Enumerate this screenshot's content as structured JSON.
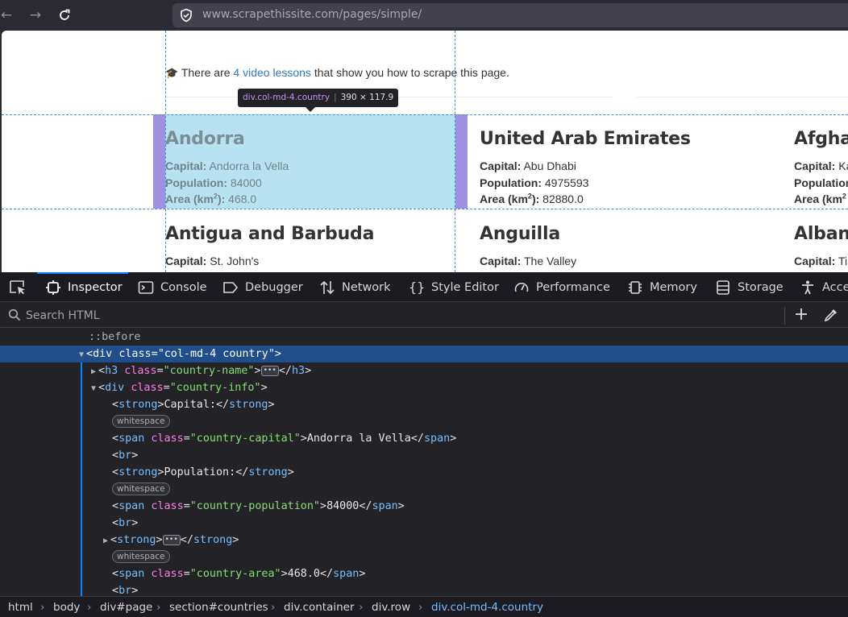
{
  "browser": {
    "url_host": "www.scrapethissite.com",
    "url_path": "/pages/simple/"
  },
  "page": {
    "lessons_pre": "There are ",
    "lessons_link": "4 video lessons",
    "lessons_post": " that show you how to scrape this page.",
    "tooltip_selector": "div.col-md-4.country",
    "tooltip_dims": "390 × 117.9",
    "countries": [
      {
        "name": "Andorra",
        "capital": "Andorra la Vella",
        "population": "84000",
        "area": "468.0"
      },
      {
        "name": "United Arab Emirates",
        "capital": "Abu Dhabi",
        "population": "4975593",
        "area": "82880.0"
      },
      {
        "name": "Afghan",
        "capital": "Ka",
        "population": "",
        "area": ""
      },
      {
        "name": "Antigua and Barbuda",
        "capital": "St. John's"
      },
      {
        "name": "Anguilla",
        "capital": "The Valley"
      },
      {
        "name": "Albani",
        "capital": "Ti"
      }
    ],
    "labels": {
      "capital": "Capital:",
      "population": "Population:",
      "area": "Area (km",
      "area_sup": "2",
      "area_end": "):"
    }
  },
  "devtools": {
    "tabs": [
      "Inspector",
      "Console",
      "Debugger",
      "Network",
      "Style Editor",
      "Performance",
      "Memory",
      "Storage",
      "Acce"
    ],
    "search_placeholder": "Search HTML",
    "tree": {
      "before": "::before",
      "div_open_tag": "div",
      "div_attr": "class",
      "div_val": "\"col-md-4 country\"",
      "h3_tag": "h3",
      "h3_val": "\"country-name\"",
      "info_val": "\"country-info\"",
      "strong_tag": "strong",
      "capital_text": "Capital:",
      "whitespace": "whitespace",
      "span_tag": "span",
      "capital_class": "\"country-capital\"",
      "capital_value": "Andorra la Vella",
      "br_tag": "br",
      "population_text": "Population:",
      "population_class": "\"country-population\"",
      "population_value": "84000",
      "area_class": "\"country-area\"",
      "area_value": "468.0"
    },
    "breadcrumbs": [
      "html",
      "body",
      "div#page",
      "section#countries",
      "div.container",
      "div.row",
      "div.col-md-4.country"
    ]
  }
}
